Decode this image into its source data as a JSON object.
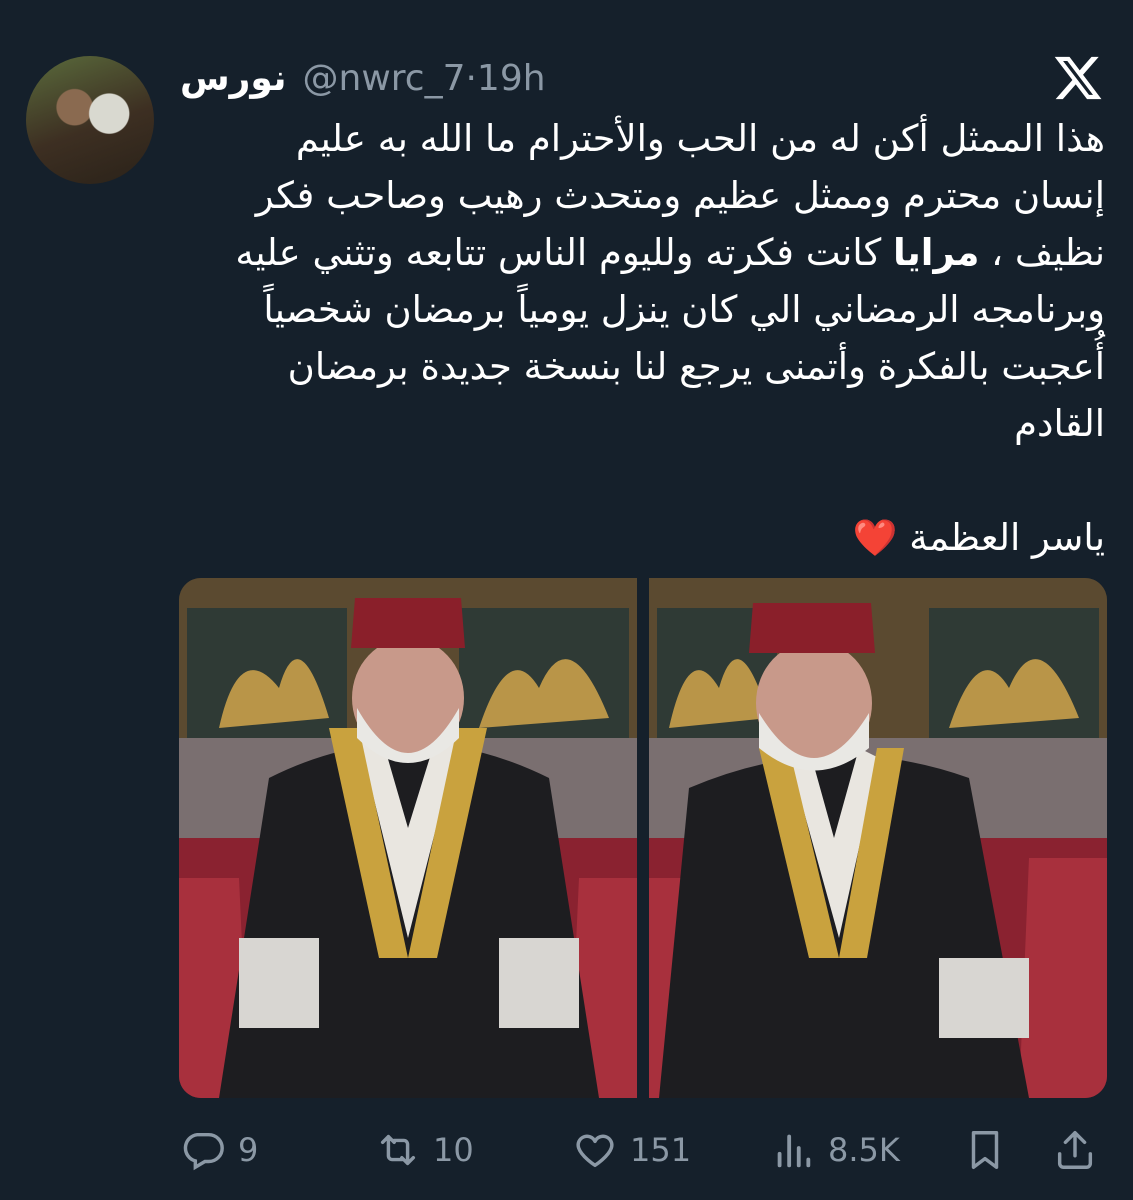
{
  "tweet": {
    "author": {
      "display_name": "نورس",
      "handle": "@nwrc_7",
      "time_separator": "·",
      "time": "19h"
    },
    "text_lines": [
      "هذا الممثل أكن له من الحب والأحترام ما الله به عليم",
      "إنسان محترم وممثل عظيم ومتحدث رهيب وصاحب فكر",
      "كانت فكرته ولليوم الناس تتابعه وتثني عليه",
      "وبرنامجه الرمضاني الي كان ينزل يومياً برمضان شخصياً",
      "أُعجبت بالفكرة وأتمنى يرجع لنا بنسخة جديدة برمضان",
      "القادم"
    ],
    "line3_prefix": "نظيف ،",
    "line3_bold": "مرايا",
    "closing_line": "ياسر العظمة",
    "closing_emoji": "❤️",
    "media_count": 2
  },
  "actions": {
    "reply_count": "9",
    "retweet_count": "10",
    "like_count": "151",
    "views_count": "8.5K"
  },
  "icons": {
    "platform": "x-logo-icon",
    "reply": "reply-icon",
    "retweet": "retweet-icon",
    "like": "heart-icon",
    "views": "views-icon",
    "bookmark": "bookmark-icon",
    "share": "share-icon"
  },
  "colors": {
    "background": "#15202b",
    "text": "#ffffff",
    "muted": "#8b98a5",
    "heart": "#e8253d"
  }
}
